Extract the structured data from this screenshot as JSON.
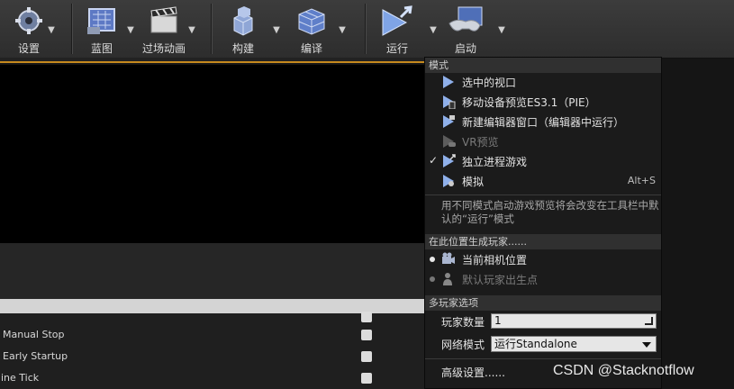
{
  "toolbar": {
    "settings_label": "设置",
    "blueprint_label": "蓝图",
    "cinematics_label": "过场动画",
    "build_label": "构建",
    "compile_label": "编译",
    "play_label": "运行",
    "launch_label": "启动"
  },
  "menu": {
    "mode_header": "模式",
    "items": [
      {
        "label": "选中的视口",
        "icon": "play-icon"
      },
      {
        "label": "移动设备预览ES3.1（PIE）",
        "icon": "mobile-preview-icon"
      },
      {
        "label": "新建编辑器窗口（编辑器中运行）",
        "icon": "new-window-icon"
      },
      {
        "label": "VR预览",
        "icon": "vr-icon",
        "disabled": true
      },
      {
        "label": "独立进程游戏",
        "icon": "standalone-icon",
        "checked": true
      },
      {
        "label": "模拟",
        "icon": "simulate-icon",
        "shortcut": "Alt+S"
      }
    ],
    "note": "用不同模式启动游戏预览将会改变在工具栏中默认的“运行”模式",
    "spawn_header": "在此位置生成玩家......",
    "spawn_items": [
      {
        "label": "当前相机位置",
        "icon": "camera-icon",
        "selected": true
      },
      {
        "label": "默认玩家出生点",
        "icon": "player-start-icon",
        "selected": false
      }
    ],
    "multiplayer_header": "多玩家选项",
    "player_count_label": "玩家数量",
    "player_count_value": "1",
    "net_mode_label": "网络模式",
    "net_mode_value": "运行Standalone",
    "advanced_label": "高级设置......"
  },
  "details": {
    "rows": [
      "Manual Stop",
      "Early Startup",
      "gine Tick"
    ]
  },
  "watermark": "CSDN @Stacknotflow"
}
